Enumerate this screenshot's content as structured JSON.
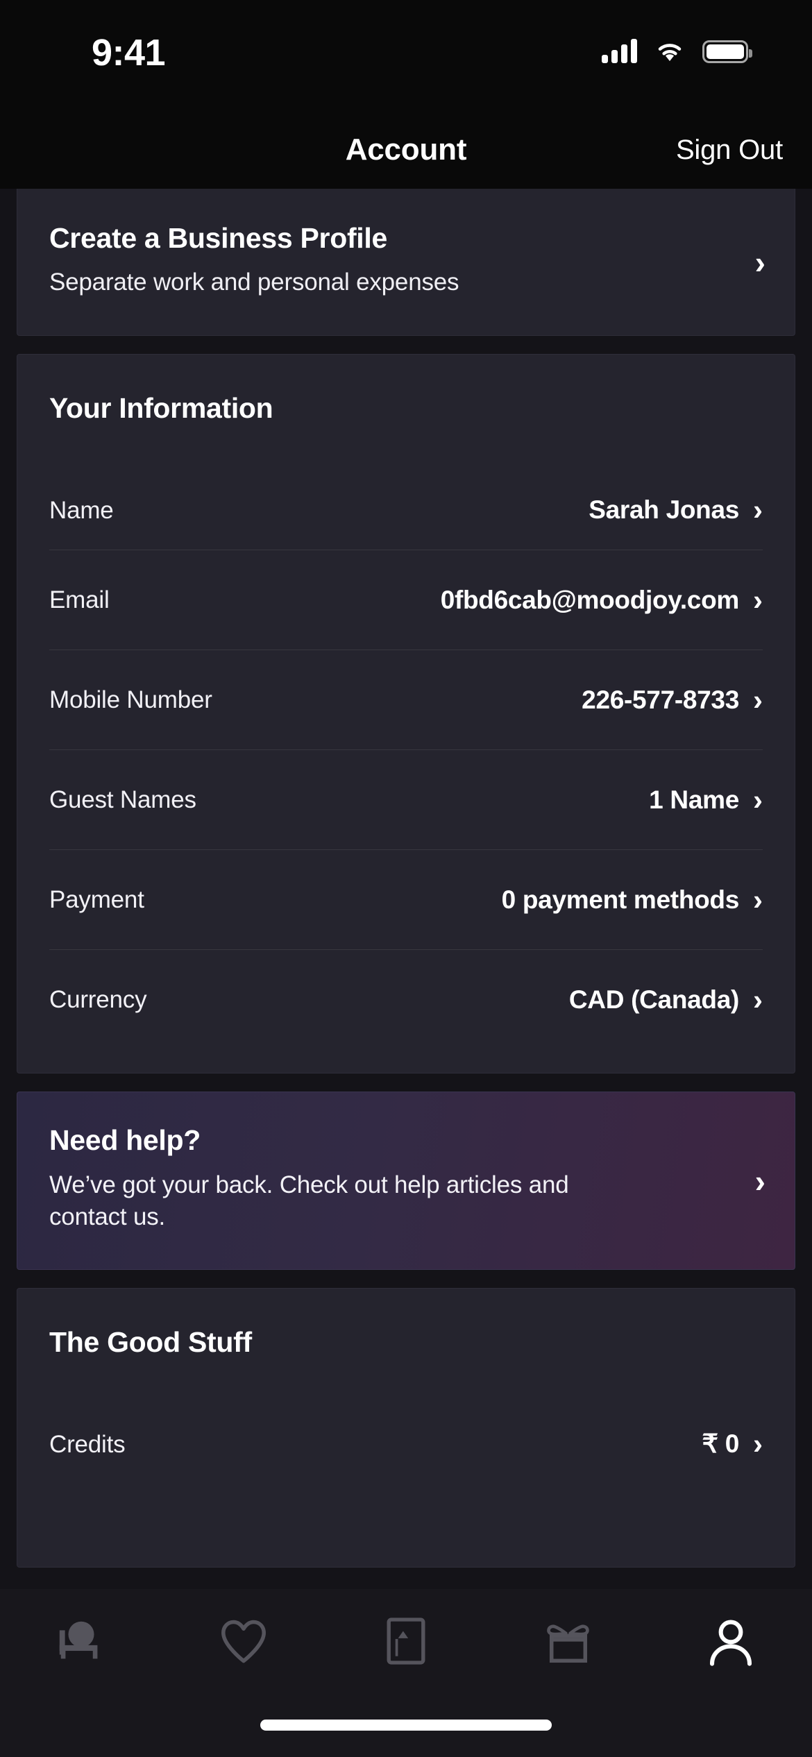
{
  "status_bar": {
    "time": "9:41",
    "cellular_icon": "cellular-bars-icon",
    "wifi_icon": "wifi-icon",
    "battery_icon": "battery-full-icon"
  },
  "nav_bar": {
    "title": "Account",
    "action_label": "Sign Out"
  },
  "business_promo": {
    "title": "Create a Business Profile",
    "subtitle": "Separate work and personal expenses",
    "chevron": "›"
  },
  "your_information": {
    "heading": "Your Information",
    "rows": [
      {
        "label": "Name",
        "value": "Sarah Jonas"
      },
      {
        "label": "Email",
        "value": "0fbd6cab@moodjoy.com"
      },
      {
        "label": "Mobile Number",
        "value": "226-577-8733"
      },
      {
        "label": "Guest Names",
        "value": "1 Name"
      },
      {
        "label": "Payment",
        "value": "0 payment methods"
      },
      {
        "label": "Currency",
        "value": "CAD (Canada)"
      }
    ]
  },
  "need_help": {
    "title": "Need help?",
    "body": "We’ve got your back. Check out help articles and contact us.",
    "chevron": "›",
    "gradient_start": "#2c2842",
    "gradient_end": "#3e2542"
  },
  "good_stuff": {
    "heading": "The Good Stuff",
    "rows": [
      {
        "label": "Credits",
        "value": "₹ 0"
      }
    ]
  },
  "tab_bar": {
    "tabs": [
      {
        "name": "stays",
        "icon": "bed-icon",
        "active": false
      },
      {
        "name": "saved",
        "icon": "heart-icon",
        "active": false
      },
      {
        "name": "trips",
        "icon": "trips-icon",
        "active": false
      },
      {
        "name": "rewards",
        "icon": "gift-icon",
        "active": false
      },
      {
        "name": "account",
        "icon": "profile-icon",
        "active": true
      }
    ],
    "inactive_color": "#55545c",
    "active_color": "#ffffff"
  },
  "colors": {
    "page_background": "#141318",
    "card_background": "#25242e",
    "status_background": "#090909",
    "divider": "#38373f"
  }
}
